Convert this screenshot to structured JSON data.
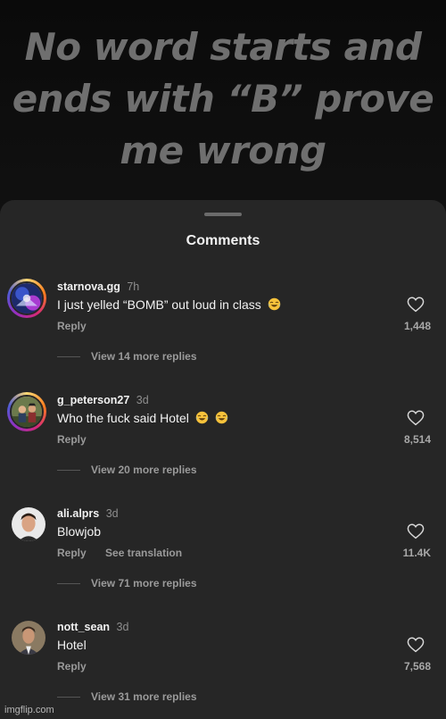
{
  "meme": {
    "caption_lines": [
      "No word starts and",
      "ends with “B” prove",
      "me wrong"
    ]
  },
  "sheet": {
    "title": "Comments"
  },
  "comments": [
    {
      "username": "starnova.gg",
      "time": "7h",
      "text": "I just yelled “BOMB” out loud in class",
      "emoji": [
        "crying-laughing-emoji"
      ],
      "reply_label": "Reply",
      "likes": "1,448",
      "view_replies": "View 14 more replies"
    },
    {
      "username": "g_peterson27",
      "time": "3d",
      "text": "Who the fuck said Hotel",
      "emoji": [
        "crying-laughing-emoji",
        "crying-laughing-emoji"
      ],
      "reply_label": "Reply",
      "likes": "8,514",
      "view_replies": "View 20 more replies"
    },
    {
      "username": "ali.alprs",
      "time": "3d",
      "text": "Blowjob",
      "emoji": [],
      "reply_label": "Reply",
      "translation_label": "See translation",
      "likes": "11.4K",
      "view_replies": "View 71 more replies"
    },
    {
      "username": "nott_sean",
      "time": "3d",
      "text": "Hotel",
      "emoji": [],
      "reply_label": "Reply",
      "likes": "7,568",
      "view_replies": "View 31 more replies"
    }
  ],
  "watermark": "imgflip.com",
  "colors": {
    "sheet_background": "#262626",
    "caption_text": "#6f6f6f",
    "secondary_text": "#9a9a9a"
  }
}
